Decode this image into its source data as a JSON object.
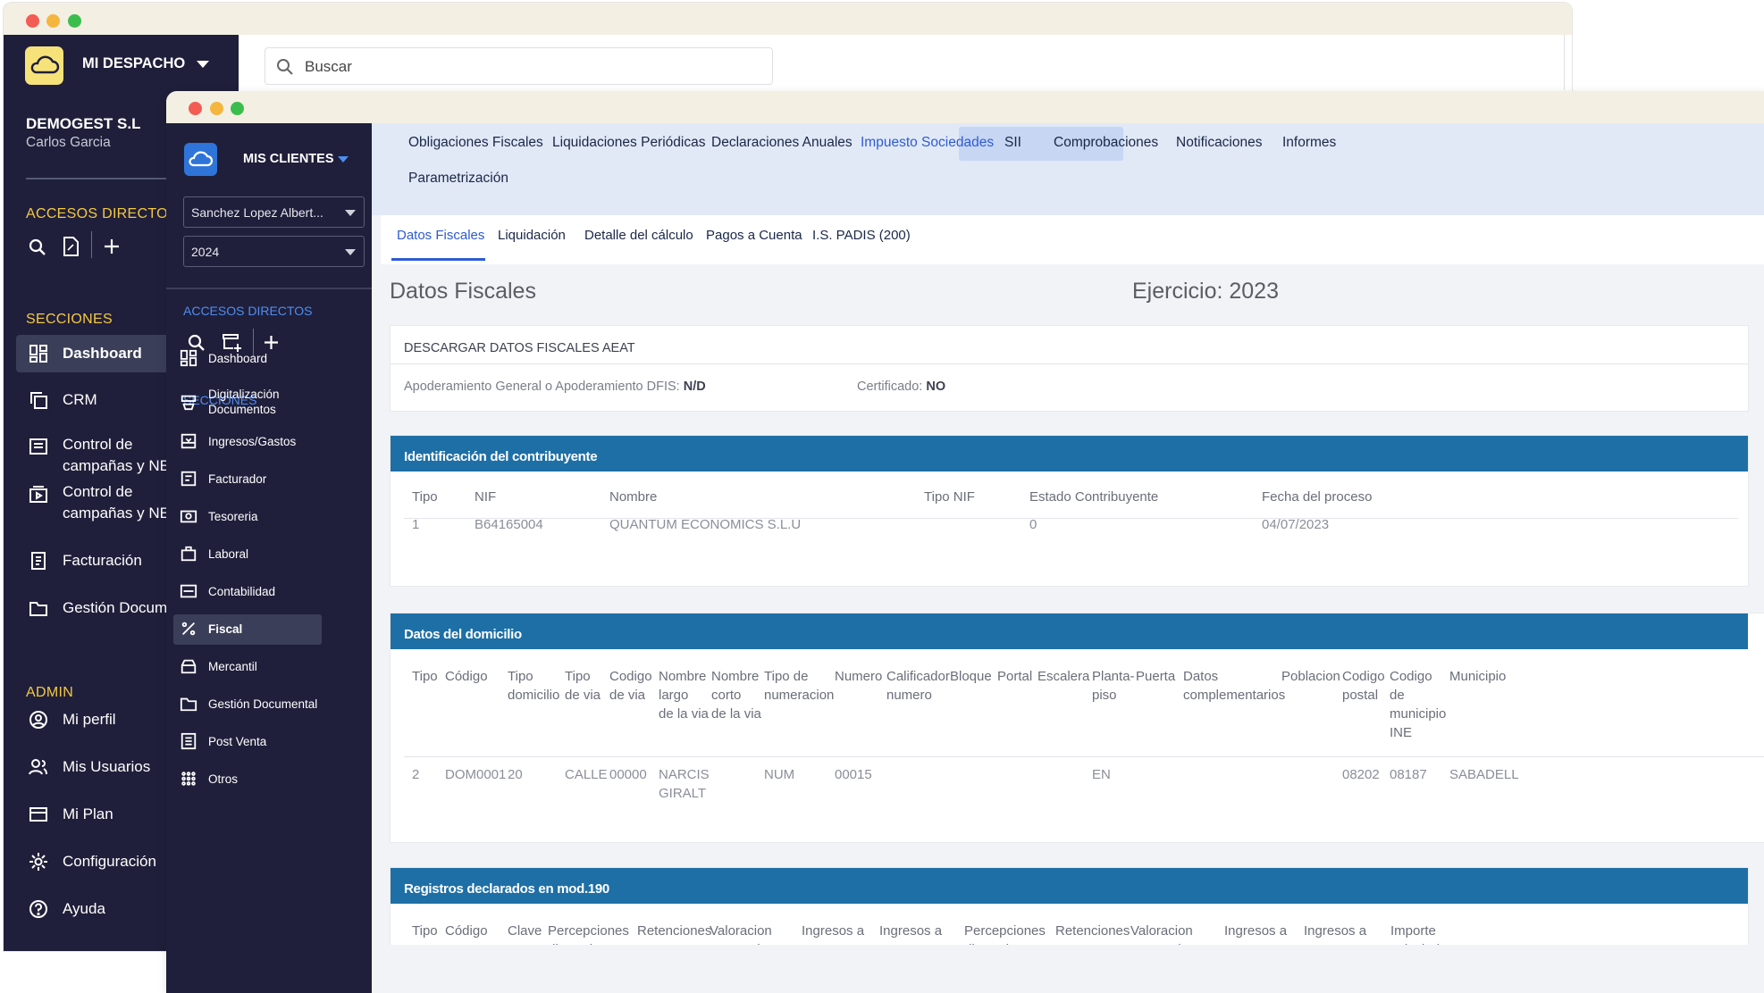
{
  "back": {
    "brand": "MI DESPACHO",
    "search_placeholder": "Buscar",
    "company": "DEMOGEST S.L",
    "user": "Carlos Garcia",
    "accesos_title": "ACCESOS DIRECTOS",
    "secciones_title": "SECCIONES",
    "nav": [
      "Dashboard",
      "CRM",
      "Control de\ncampañas y NE",
      "Control de\ncampañas y NE",
      "Facturación",
      "Gestión Docum"
    ],
    "admin_title": "ADMIN",
    "admin": [
      "Mi perfil",
      "Mis Usuarios",
      "Mi Plan",
      "Configuración",
      "Ayuda"
    ]
  },
  "front": {
    "brand": "MIS CLIENTES",
    "client_select": "Sanchez Lopez Albert...",
    "year_select": "2024",
    "accesos_title": "ACCESOS DIRECTOS",
    "secciones_title": "SECCIONES",
    "nav": [
      "Dashboard",
      "Digitalización\nDocumentos",
      "Ingresos/Gastos",
      "Facturador",
      "Tesoreria",
      "Laboral",
      "Contabilidad",
      "Fiscal",
      "Mercantil",
      "Gestión Documental",
      "Post Venta",
      "Otros"
    ],
    "active_nav": "Fiscal",
    "tabs": [
      "Obligaciones Fiscales",
      "Liquidaciones Periódicas",
      "Declaraciones Anuales",
      "Impuesto Sociedades",
      "SII",
      "Comprobaciones",
      "Notificaciones",
      "Informes",
      "Parametrización"
    ],
    "active_tab": "Impuesto Sociedades",
    "subtabs": [
      "Datos Fiscales",
      "Liquidación",
      "Detalle del cálculo",
      "Pagos a Cuenta",
      "I.S. PADIS (200)"
    ],
    "active_subtab": "Datos Fiscales",
    "page_title": "Datos Fiscales",
    "ejercicio": "Ejercicio: 2023",
    "aeat": {
      "title": "DESCARGAR DATOS FISCALES AEAT",
      "apoderamiento_label": "Apoderamiento General o Apoderamiento DFIS:",
      "apoderamiento_value": "N/D",
      "certificado_label": "Certificado:",
      "certificado_value": "NO"
    },
    "identificacion": {
      "title": "Identificación del contribuyente",
      "headers": [
        "Tipo",
        "NIF",
        "Nombre",
        "Tipo NIF",
        "Estado Contribuyente",
        "Fecha del proceso"
      ],
      "row": [
        "1",
        "B64165004",
        "QUANTUM ECONOMICS S.L.U",
        "",
        "0",
        "04/07/2023"
      ]
    },
    "domicilio": {
      "title": "Datos del domicilio",
      "headers": [
        "Tipo",
        "Código",
        "Tipo\ndomicilio",
        "Tipo\nde via",
        "Codigo\nde via",
        "Nombre\nlargo\nde la via",
        "Nombre\ncorto\nde la via",
        "Tipo de\nnumeracion",
        "Numero",
        "Calificador\nnumero",
        "Bloque",
        "Portal",
        "Escalera",
        "Planta-\npiso",
        "Puerta",
        "Datos\ncomplementarios",
        "Poblacion",
        "Codigo\npostal",
        "Codigo\nde\nmunicipio\nINE",
        "Municipio"
      ],
      "row": [
        "2",
        "DOM0001",
        "20",
        "CALLE",
        "00000",
        "NARCIS\nGIRALT",
        "",
        "NUM",
        "00015",
        "",
        "",
        "",
        "",
        "EN",
        "",
        "",
        "",
        "08202",
        "08187",
        "SABADELL"
      ]
    },
    "mod190": {
      "title": "Registros declarados en mod.190",
      "headers": [
        "Tipo",
        "Código\nconcepto",
        "Clave",
        "Percepciones\ndinerarias",
        "Retenciones",
        "Valoracion\npercepciones",
        "Ingresos a\ncuenta",
        "Ingresos a\ncuenta",
        "Percepciones\ndinerarias",
        "Retenciones\nILT",
        "Valoracion\npercepciones en",
        "Ingresos a\ncuenta",
        "Ingresos a\ncuenta",
        "Importe\ncalculado"
      ]
    }
  },
  "colors": {
    "sidebar": "#1f1f3b",
    "accent_yellow": "#f5c842",
    "header_blue": "#1e6fa6",
    "link_blue": "#2f5bd3"
  }
}
